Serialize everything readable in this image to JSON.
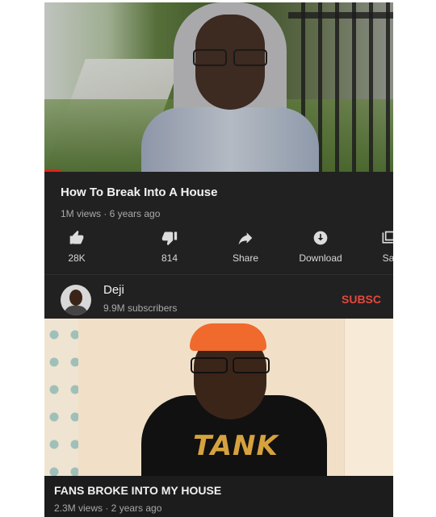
{
  "video1": {
    "title": "How To Break Into A House",
    "meta": "1M views · 6 years ago",
    "actions": [
      {
        "icon": "thumbs-up-icon",
        "label": "28K"
      },
      {
        "icon": "thumbs-down-icon",
        "label": "814"
      },
      {
        "icon": "share-icon",
        "label": "Share"
      },
      {
        "icon": "download-icon",
        "label": "Download"
      },
      {
        "icon": "save-icon",
        "label": "Sa"
      }
    ],
    "channel": {
      "name": "Deji",
      "subscribers": "9.9M subscribers",
      "subscribe_label": "SUBSC"
    }
  },
  "video2": {
    "title": "FANS BROKE INTO MY HOUSE",
    "meta": "2.3M views · 2 years ago",
    "shirt_text": "TANK"
  },
  "colors": {
    "panel_bg": "#212121",
    "subscribe": "#e5473b",
    "progress": "#e62117"
  }
}
